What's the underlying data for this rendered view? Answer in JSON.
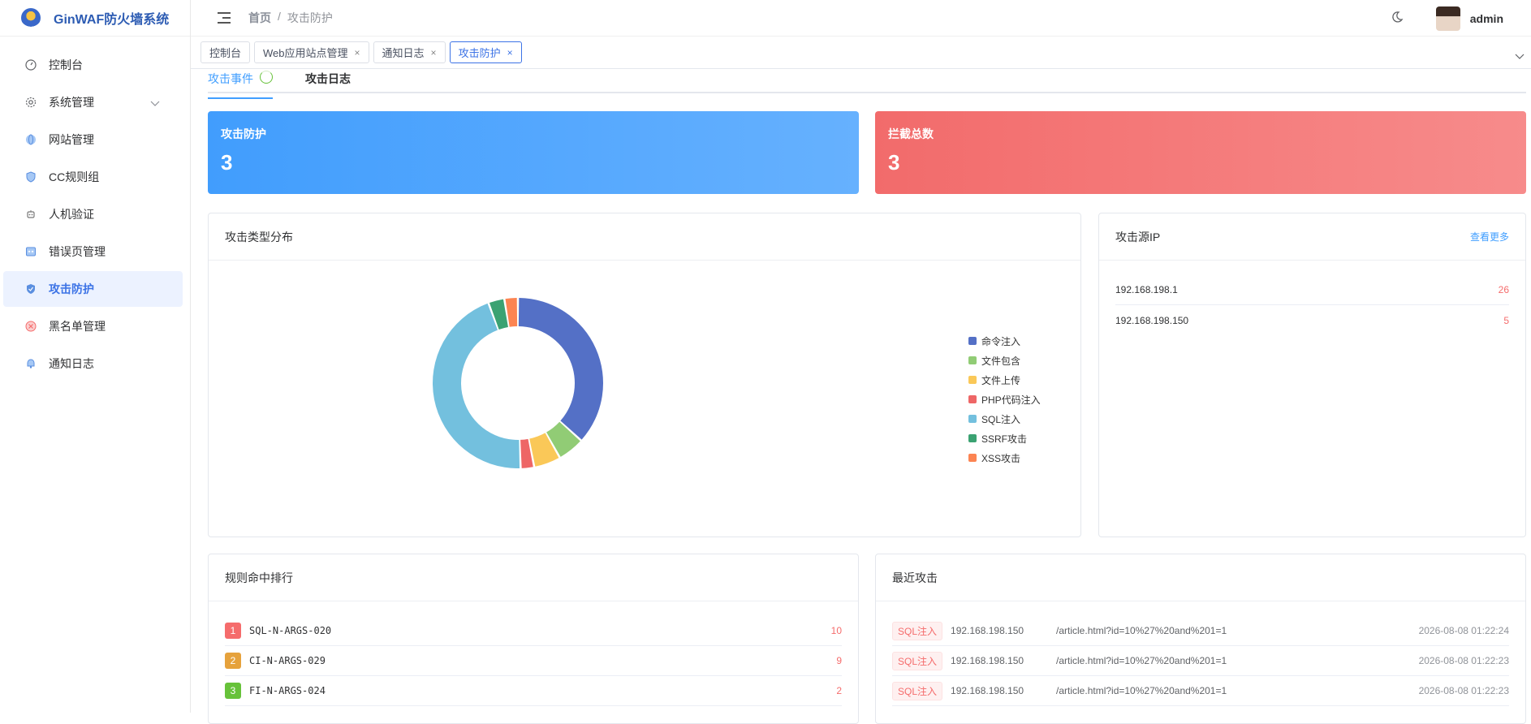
{
  "app": {
    "title": "GinWAF防火墙系统"
  },
  "sidebar": {
    "items": [
      {
        "label": "控制台",
        "icon": "dashboard-icon"
      },
      {
        "label": "系统管理",
        "icon": "gear-icon"
      },
      {
        "label": "网站管理",
        "icon": "globe-icon"
      },
      {
        "label": "CC规则组",
        "icon": "shield-icon"
      },
      {
        "label": "人机验证",
        "icon": "robot-icon"
      },
      {
        "label": "错误页管理",
        "icon": "error-page-icon"
      },
      {
        "label": "攻击防护",
        "icon": "shield-check-icon"
      },
      {
        "label": "黑名单管理",
        "icon": "block-icon"
      },
      {
        "label": "通知日志",
        "icon": "bell-icon"
      }
    ]
  },
  "header": {
    "breadcrumb": [
      "首页",
      "攻击防护"
    ],
    "breadcrumb_separator": "/",
    "user": "admin"
  },
  "tags": [
    {
      "label": "控制台",
      "closable": false
    },
    {
      "label": "Web应用站点管理",
      "closable": true
    },
    {
      "label": "通知日志",
      "closable": true
    },
    {
      "label": "攻击防护",
      "closable": true,
      "active": true
    }
  ],
  "tag_close_glyph": "×",
  "subtabs": [
    "攻击事件",
    "攻击日志"
  ],
  "stats": [
    {
      "label": "攻击防护",
      "value": "3"
    },
    {
      "label": "拦截总数",
      "value": "3"
    }
  ],
  "attack_type": {
    "title": "攻击类型分布",
    "chart_data": {
      "type": "pie",
      "categories": [
        "命令注入",
        "文件包含",
        "文件上传",
        "PHP代码注入",
        "SQL注入",
        "SSRF攻击",
        "XSS攻击"
      ],
      "values": [
        36,
        5,
        5,
        2.5,
        44,
        3,
        2.5
      ],
      "colors": [
        "#5470c6",
        "#91cc75",
        "#fac858",
        "#ee6666",
        "#73c0de",
        "#3ba272",
        "#fc8452"
      ]
    }
  },
  "attack_ip": {
    "title": "攻击源IP",
    "more": "查看更多",
    "rows": [
      {
        "ip": "192.168.198.1",
        "count": "26"
      },
      {
        "ip": "192.168.198.150",
        "count": "5"
      }
    ]
  },
  "rule_rank": {
    "title": "规则命中排行",
    "rows": [
      {
        "rank": "1",
        "rule": "SQL-N-ARGS-020",
        "count": "10",
        "color": "#f56c6c"
      },
      {
        "rank": "2",
        "rule": "CI-N-ARGS-029",
        "count": "9",
        "color": "#e6a23c"
      },
      {
        "rank": "3",
        "rule": "FI-N-ARGS-024",
        "count": "2",
        "color": "#67c23a"
      }
    ]
  },
  "recent": {
    "title": "最近攻击",
    "rows": [
      {
        "type": "SQL注入",
        "ip": "192.168.198.150",
        "url": "/article.html?id=10%27%20and%201=1",
        "time": "2026-08-08 01:22:24"
      },
      {
        "type": "SQL注入",
        "ip": "192.168.198.150",
        "url": "/article.html?id=10%27%20and%201=1",
        "time": "2026-08-08 01:22:23"
      },
      {
        "type": "SQL注入",
        "ip": "192.168.198.150",
        "url": "/article.html?id=10%27%20and%201=1",
        "time": "2026-08-08 01:22:23"
      }
    ]
  }
}
